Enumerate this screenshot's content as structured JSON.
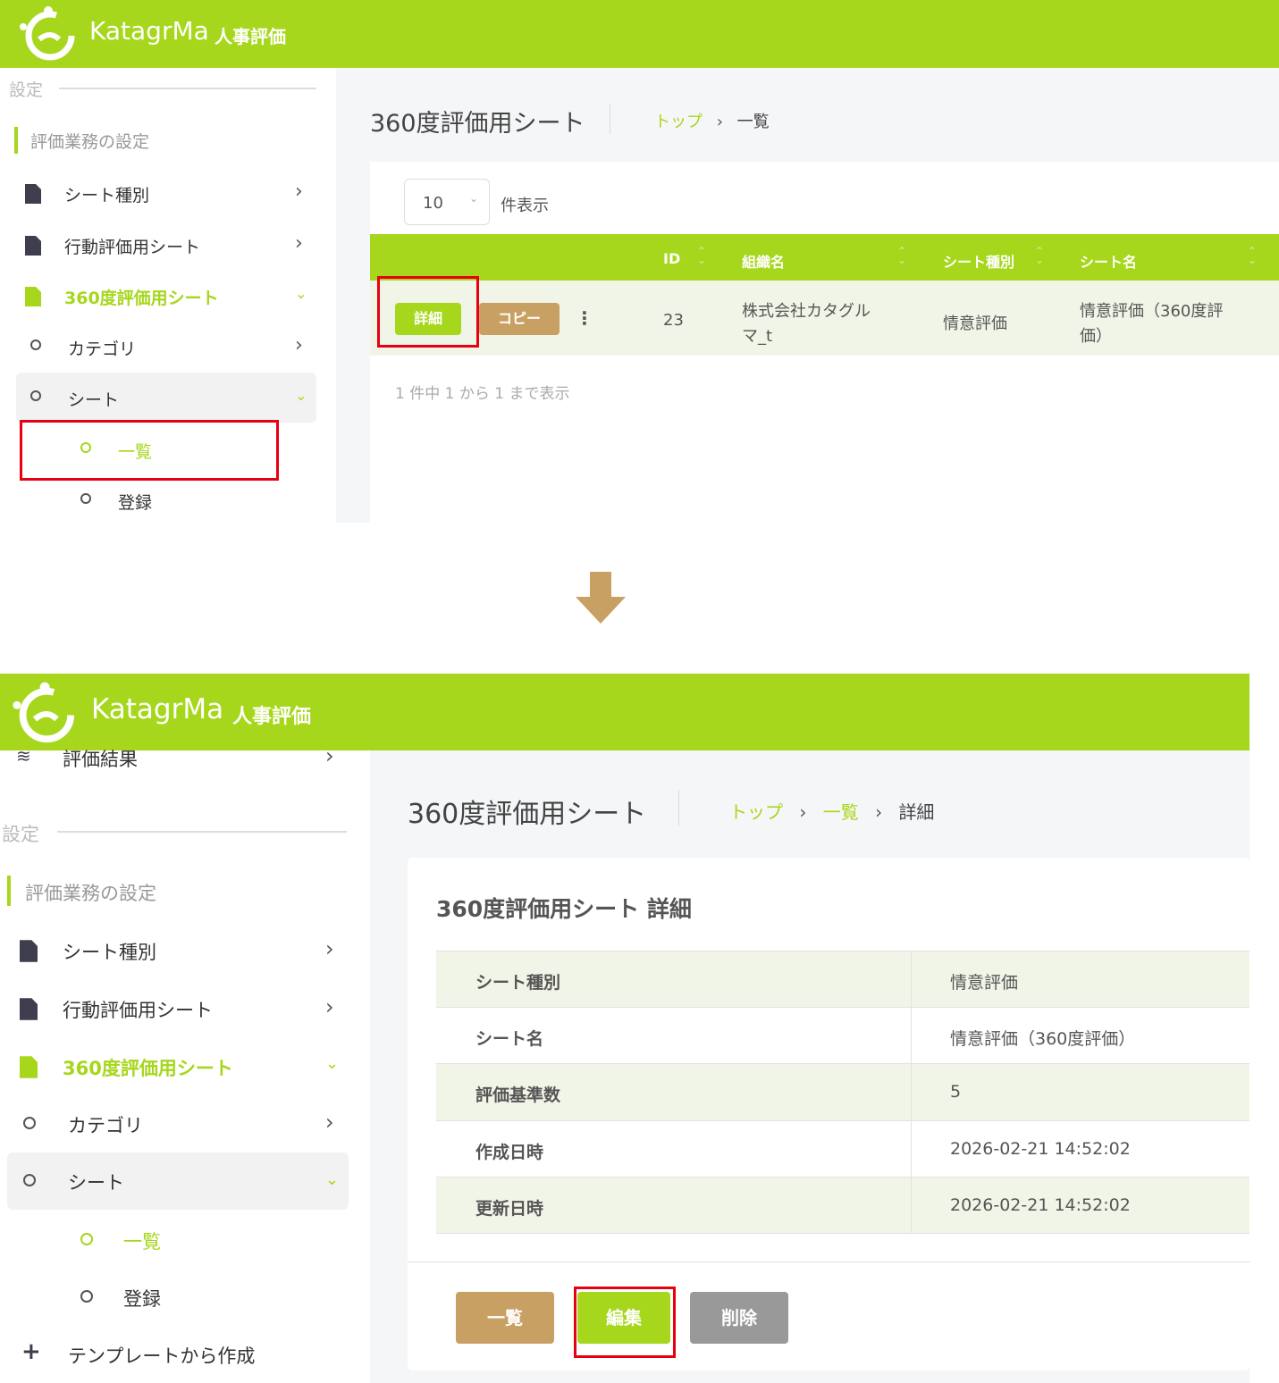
{
  "app": {
    "brand": "KatagrMa",
    "product": "人事評価"
  },
  "colors": {
    "accent": "#a6d71c",
    "tan": "#c9a063",
    "gray": "#999999",
    "highlight": "#e60012"
  },
  "shot1": {
    "sidebar": {
      "section": "設定",
      "group": "評価業務の設定",
      "items": [
        {
          "label": "シート種別",
          "icon": "document-icon"
        },
        {
          "label": "行動評価用シート",
          "icon": "document-icon"
        },
        {
          "label": "360度評価用シート",
          "icon": "document-icon"
        },
        {
          "label": "カテゴリ",
          "icon": "circle-icon"
        },
        {
          "label": "シート",
          "icon": "circle-icon"
        },
        {
          "label": "一覧",
          "icon": "circle-icon"
        },
        {
          "label": "登録",
          "icon": "circle-icon"
        }
      ]
    },
    "page_title": "360度評価用シート",
    "breadcrumb": {
      "top": "トップ",
      "current": "一覧"
    },
    "length_select": {
      "value": "10",
      "suffix": "件表示"
    },
    "table": {
      "headers": [
        "ID",
        "組織名",
        "シート種別",
        "シート名"
      ],
      "row": {
        "detail_button": "詳細",
        "copy_button": "コピー",
        "menu": "⋮",
        "id": "23",
        "org_line1": "株式会社カタグル",
        "org_line2": "マ_t",
        "sheet_type": "情意評価",
        "sheet_name_line1": "情意評価（360度評",
        "sheet_name_line2": "価）"
      }
    },
    "info": "1 件中 1 から 1 まで表示"
  },
  "shot2": {
    "sidebar": {
      "partial_item": "評価結果",
      "section": "設定",
      "group": "評価業務の設定",
      "items": [
        {
          "label": "シート種別"
        },
        {
          "label": "行動評価用シート"
        },
        {
          "label": "360度評価用シート"
        },
        {
          "label": "カテゴリ"
        },
        {
          "label": "シート"
        },
        {
          "label": "一覧"
        },
        {
          "label": "登録"
        },
        {
          "label": "テンプレートから作成"
        }
      ]
    },
    "page_title": "360度評価用シート",
    "breadcrumb": {
      "top": "トップ",
      "list": "一覧",
      "current": "詳細"
    },
    "card_title": "360度評価用シート 詳細",
    "details": [
      {
        "label": "シート種別",
        "value": "情意評価"
      },
      {
        "label": "シート名",
        "value": "情意評価（360度評価）"
      },
      {
        "label": "評価基準数",
        "value": "5"
      },
      {
        "label": "作成日時",
        "value": "2026-02-21 14:52:02"
      },
      {
        "label": "更新日時",
        "value": "2026-02-21 14:52:02"
      }
    ],
    "buttons": {
      "list": "一覧",
      "edit": "編集",
      "delete": "削除"
    }
  }
}
